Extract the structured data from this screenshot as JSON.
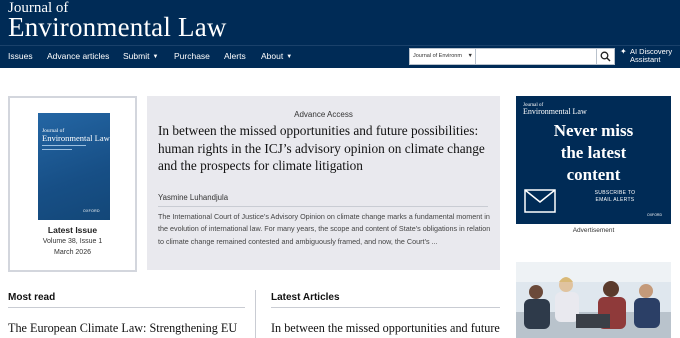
{
  "header": {
    "journal_title_pre": "Journal of",
    "journal_title_main": "Environmental Law"
  },
  "nav": {
    "items": [
      {
        "label": "Issues",
        "dropdown": false
      },
      {
        "label": "Advance articles",
        "dropdown": false
      },
      {
        "label": "Submit",
        "dropdown": true
      },
      {
        "label": "Purchase",
        "dropdown": false
      },
      {
        "label": "Alerts",
        "dropdown": false
      },
      {
        "label": "About",
        "dropdown": true
      }
    ],
    "search_scope": "Journal of Environm",
    "search_placeholder": "",
    "ai_button_line1": "AI Discovery",
    "ai_button_line2": "Assistant"
  },
  "latest_issue": {
    "cover_title_pre": "Journal of",
    "cover_title_main": "Environmental Law",
    "label": "Latest Issue",
    "volume": "Volume 38, Issue 1",
    "date": "March 2026"
  },
  "featured": {
    "type": "Advance Access",
    "title": "In between the missed opportunities and future possibilities: human rights in the ICJ’s advisory opinion on climate change and the prospects for climate litigation",
    "author": "Yasmine Luhandjula",
    "abstract": "The International Court of Justice’s Advisory Opinion on climate change marks a fundamental moment in the evolution of international law. For many years, the scope and content of State’s obligations in relation to climate change remained contested and ambiguously framed, and now, the Court’s ..."
  },
  "ad": {
    "journal_pre": "Journal of",
    "journal_main": "Environmental Law",
    "headline_line1": "Never miss",
    "headline_line2": "the latest",
    "headline_line3": "content",
    "subscribe_line1": "SUBSCRIBE TO",
    "subscribe_line2": "EMAIL ALERTS",
    "publisher": "OXFORD",
    "caption": "Advertisement"
  },
  "most_read": {
    "heading": "Most read",
    "first_item": "The European Climate Law: Strengthening EU"
  },
  "latest_articles": {
    "heading": "Latest Articles",
    "first_item": "In between the missed opportunities and future"
  },
  "colors": {
    "brand_navy": "#002b56",
    "panel_grey": "#e9e9ee"
  }
}
